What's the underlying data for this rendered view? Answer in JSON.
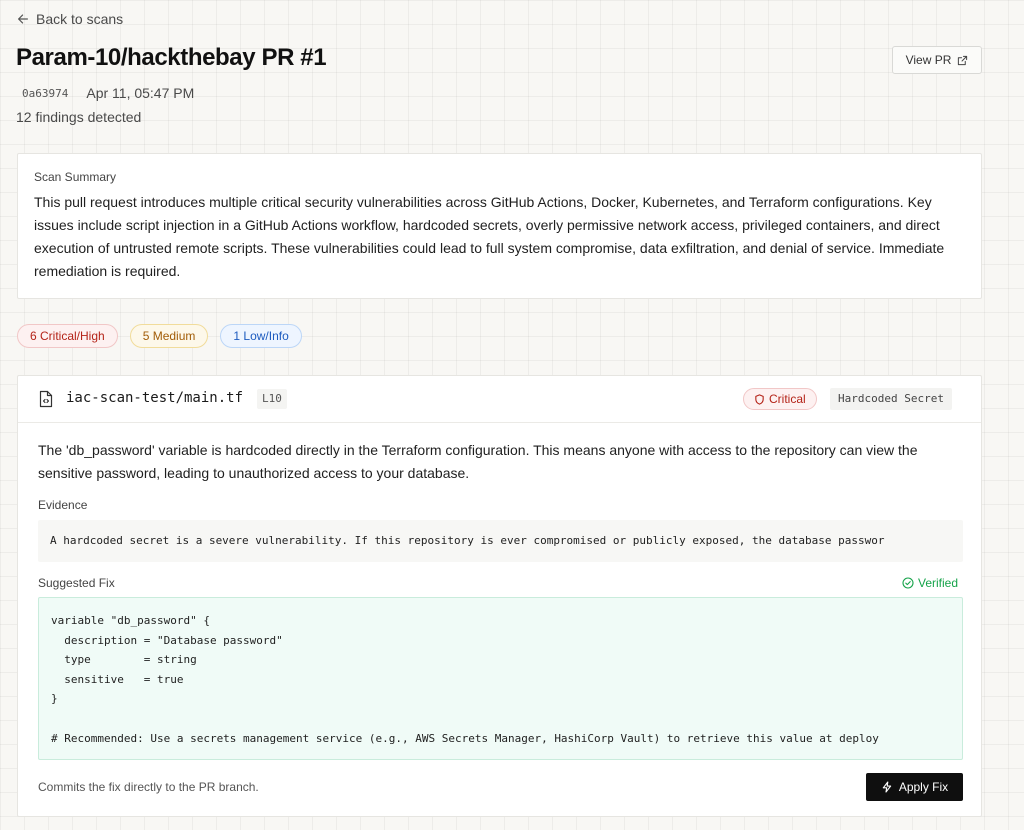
{
  "nav": {
    "back_label": "Back to scans"
  },
  "header": {
    "title": "Param-10/hackthebay PR #1",
    "view_pr_label": "View PR",
    "commit_hash": "0a63974",
    "timestamp": "Apr 11, 05:47 PM",
    "findings_count": "12 findings detected"
  },
  "summary": {
    "heading": "Scan Summary",
    "text": "This pull request introduces multiple critical security vulnerabilities across GitHub Actions, Docker, Kubernetes, and Terraform configurations. Key issues include script injection in a GitHub Actions workflow, hardcoded secrets, overly permissive network access, privileged containers, and direct execution of untrusted remote scripts. These vulnerabilities could lead to full system compromise, data exfiltration, and denial of service. Immediate remediation is required."
  },
  "severity_filters": [
    {
      "label": "6 Critical/High",
      "level": "critical"
    },
    {
      "label": "5 Medium",
      "level": "medium"
    },
    {
      "label": "1 Low/Info",
      "level": "low"
    }
  ],
  "finding": {
    "file_path": "iac-scan-test/main.tf",
    "line": "L10",
    "severity": "Critical",
    "category": "Hardcoded Secret",
    "description": "The 'db_password' variable is hardcoded directly in the Terraform configuration. This means anyone with access to the repository can view the sensitive password, leading to unauthorized access to your database.",
    "evidence_label": "Evidence",
    "evidence_text": "A hardcoded secret is a severe vulnerability. If this repository is ever compromised or publicly exposed, the database passwor",
    "fix_label": "Suggested Fix",
    "verified_label": "Verified",
    "fix_code_lines": [
      "variable \"db_password\" {",
      "  description = \"Database password\"",
      "  type        = string",
      "  sensitive   = true",
      "}",
      "",
      "# Recommended: Use a secrets management service (e.g., AWS Secrets Manager, HashiCorp Vault) to retrieve this value at deploy"
    ],
    "commit_note": "Commits the fix directly to the PR branch.",
    "apply_label": "Apply Fix"
  },
  "colors": {
    "critical": "#b42318",
    "medium": "#a15c07",
    "low": "#1d5bbf",
    "verified": "#16a34a",
    "fix_background": "#f0fbf7",
    "primary_button": "#0f0f0f"
  },
  "icons": {
    "back": "arrow-left-icon",
    "external_link": "external-link-icon",
    "file": "file-code-icon",
    "severity": "shield-icon",
    "verified": "check-circle-icon",
    "apply": "lightning-icon"
  }
}
